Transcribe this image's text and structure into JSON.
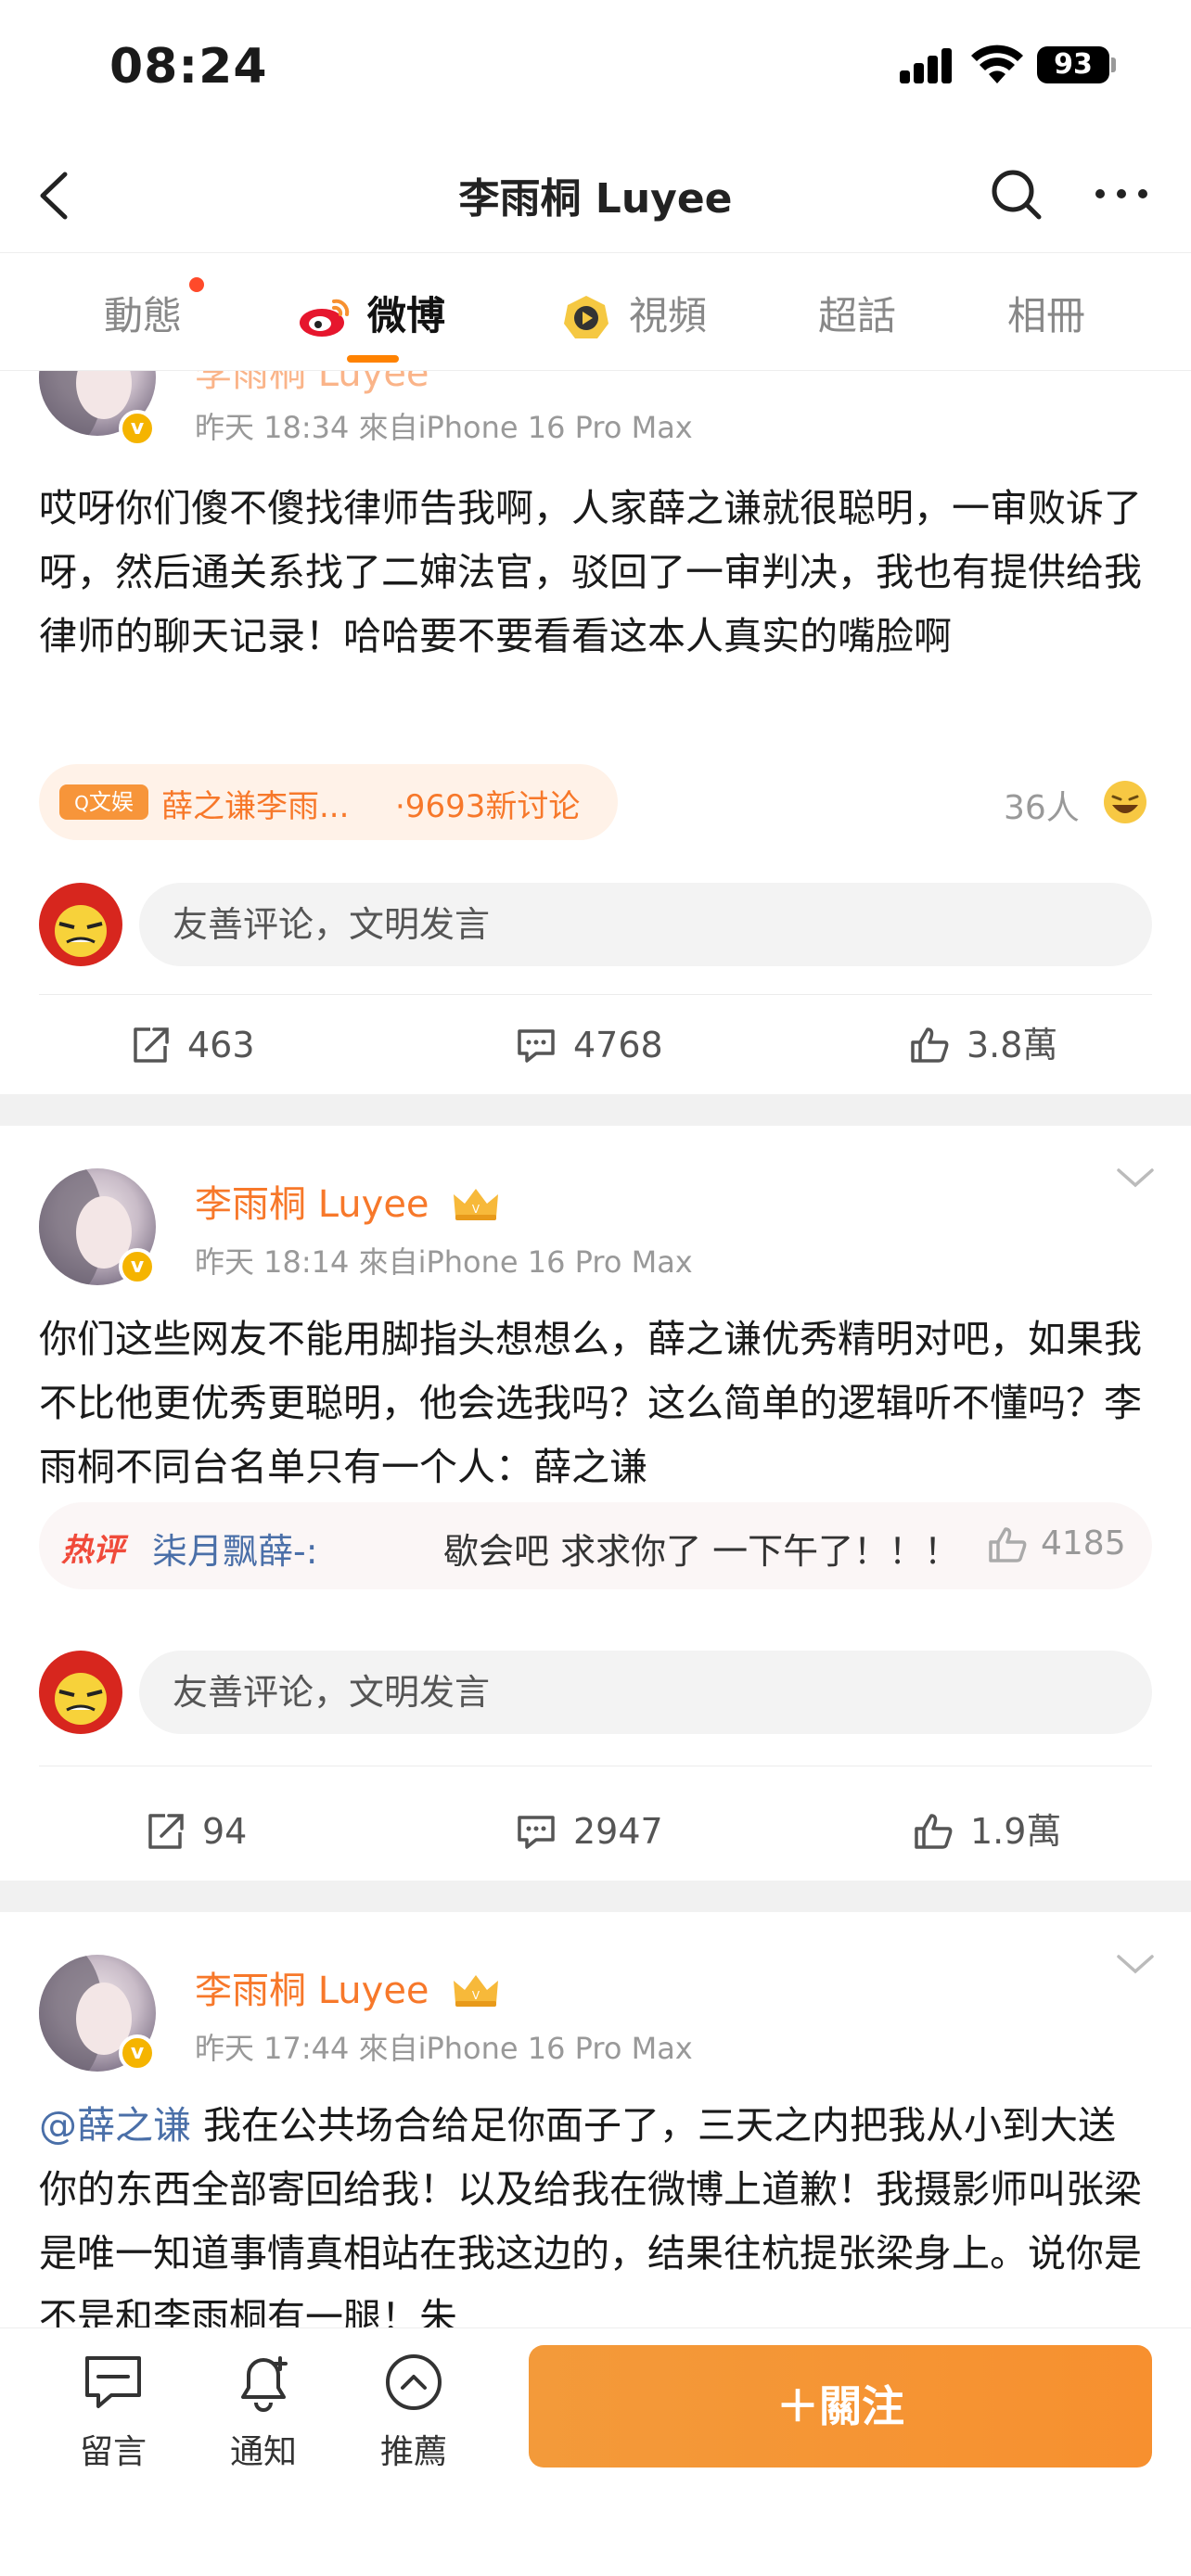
{
  "status_bar": {
    "time": "08:24",
    "battery": "93"
  },
  "header": {
    "title": "李雨桐 Luyee"
  },
  "tabs": [
    {
      "label": "動態"
    },
    {
      "label": "微博"
    },
    {
      "label": "視頻"
    },
    {
      "label": "超話"
    },
    {
      "label": "相冊"
    }
  ],
  "posts": [
    {
      "partial_username": "李雨桐 Luyee",
      "meta": "昨天 18:34  來自iPhone 16 Pro Max",
      "text": "哎呀你们傻不傻找律师告我啊，人家薛之谦就很聪明，一审败诉了呀，然后通关系找了二婶法官，驳回了一审判决，我也有提供给我律师的聊天记录！哈哈要不要看看这本人真实的嘴脸啊",
      "topic": {
        "tag": "文娱",
        "name": "薛之谦李雨...",
        "count": "·9693新讨论"
      },
      "people": "36人",
      "comment_placeholder": "友善评论，文明发言",
      "actions": {
        "share": "463",
        "comment": "4768",
        "like": "3.8萬"
      }
    },
    {
      "username": "李雨桐 Luyee",
      "meta": "昨天 18:14  來自iPhone 16 Pro Max",
      "text": "你们这些网友不能用脚指头想想么，薛之谦优秀精明对吧，如果我不比他更优秀更聪明，他会选我吗？这么简单的逻辑听不懂吗？李雨桐不同台名单只有一个人：薛之谦",
      "hot_comment": {
        "badge": "热评",
        "user": "柒月飘薛-:",
        "text": "歇会吧 求求你了 一下午了！！！",
        "likes": "4185"
      },
      "comment_placeholder": "友善评论，文明发言",
      "actions": {
        "share": "94",
        "comment": "2947",
        "like": "1.9萬"
      }
    },
    {
      "username": "李雨桐 Luyee",
      "meta": "昨天 17:44  來自iPhone 16 Pro Max",
      "mention": "@薛之谦",
      "text": " 我在公共场合给足你面子了，三天之内把我从小到大送你的东西全部寄回给我！以及给我在微博上道歉！我摄影师叫张梁是唯一知道事情真相站在我这边的，结果往杭提张梁身上。说你是不是和李雨桐有一腿！朱"
    }
  ],
  "bottom_bar": {
    "items": [
      {
        "label": "留言"
      },
      {
        "label": "通知"
      },
      {
        "label": "推薦"
      }
    ],
    "follow_label": "＋關注"
  },
  "colors": {
    "accent": "#f7782a",
    "link": "#4a6fa8",
    "hot": "#f04a3a"
  },
  "icons": [
    "back-icon",
    "search-icon",
    "more-icon",
    "weibo-icon",
    "video-icon",
    "crown-icon",
    "share-icon",
    "comment-icon",
    "like-icon",
    "message-icon",
    "bell-icon",
    "recommend-icon"
  ]
}
